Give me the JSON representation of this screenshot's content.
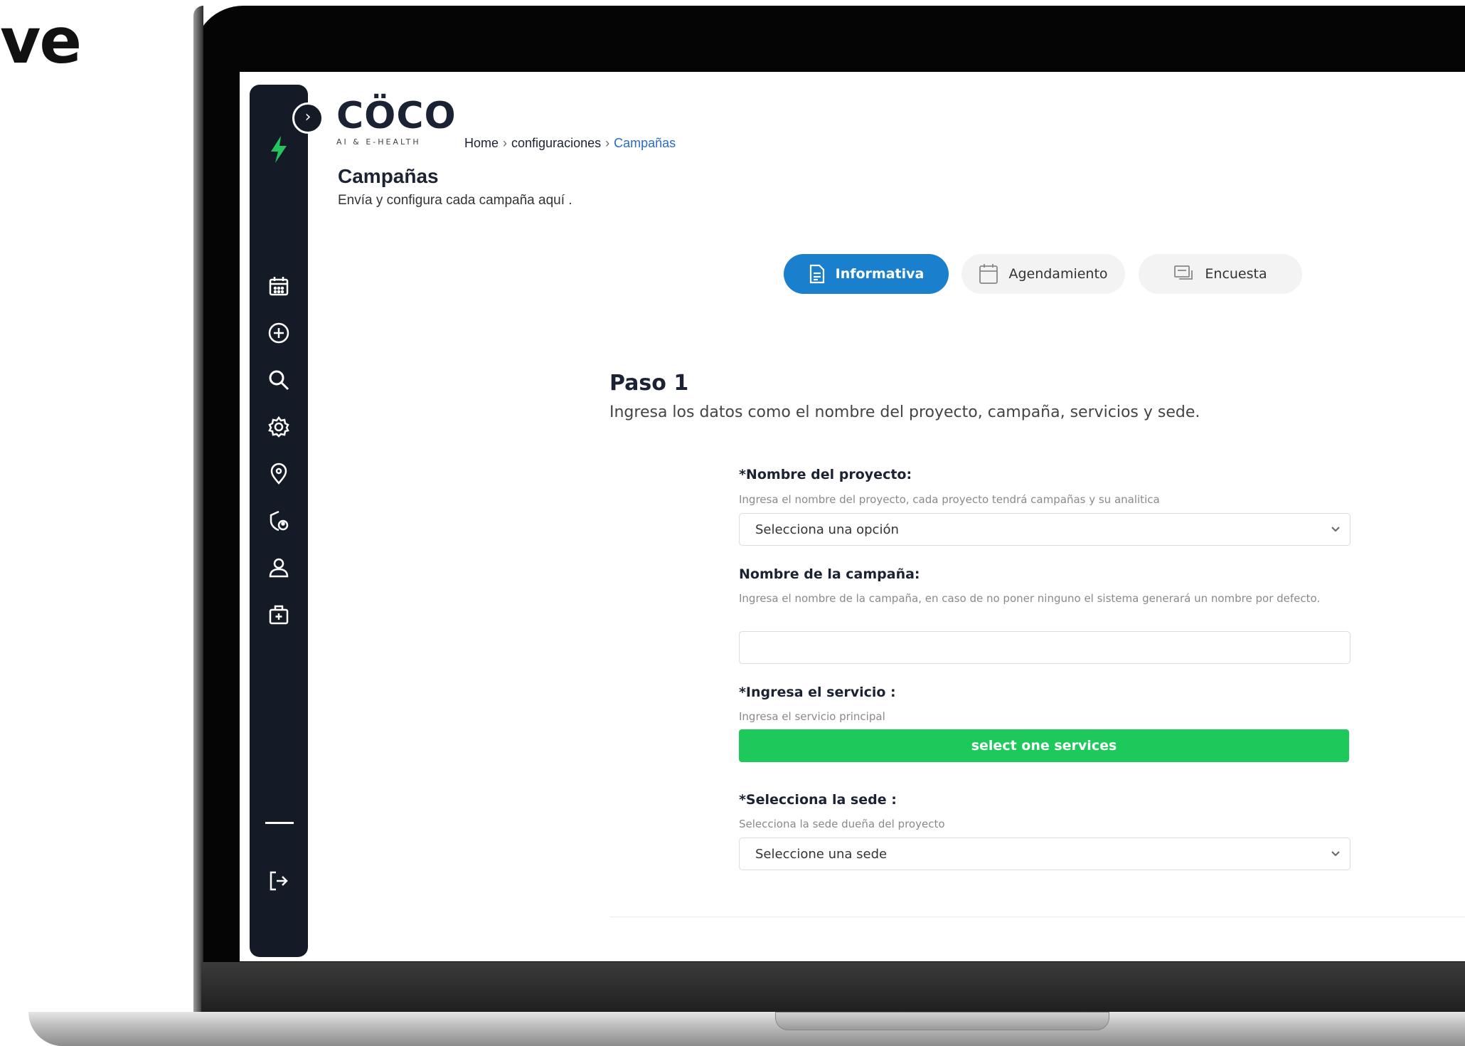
{
  "heading_fragment": "ve",
  "brand": {
    "logo_text": "CÖCO",
    "logo_subtitle": "AI & E-HEALTH"
  },
  "breadcrumb": {
    "home": "Home",
    "section": "configuraciones",
    "current": "Campañas"
  },
  "page": {
    "title": "Campañas",
    "subtitle": "Envía y configura cada campaña aquí ."
  },
  "tabs": [
    {
      "label": "Informativa",
      "icon": "document-icon",
      "active": true
    },
    {
      "label": "Agendamiento",
      "icon": "calendar-icon",
      "active": false
    },
    {
      "label": "Encuesta",
      "icon": "chat-icon",
      "active": false
    }
  ],
  "step": {
    "title": "Paso 1",
    "description": "Ingresa los datos como el nombre del proyecto, campaña, servicios y sede."
  },
  "form": {
    "project": {
      "label": "*Nombre del proyecto:",
      "help": "Ingresa el nombre del proyecto, cada proyecto tendrá campañas y su analitica",
      "value": "Selecciona una opción"
    },
    "campaign": {
      "label": "Nombre de la campaña:",
      "help": "Ingresa el nombre de la campaña, en caso de no poner ninguno el sistema generará un nombre por defecto.",
      "value": ""
    },
    "service": {
      "label": "*Ingresa el servicio :",
      "help": "Ingresa el servicio principal",
      "button_label": "select one services"
    },
    "site": {
      "label": "*Selecciona la sede :",
      "help": "Selecciona la sede dueña del proyecto",
      "value": "Seleccione una sede"
    }
  },
  "sidebar_icons": [
    "bolt-icon",
    "calendar-icon",
    "add-circle-icon",
    "search-icon",
    "settings-icon",
    "location-icon",
    "shield-user-icon",
    "user-icon",
    "medical-kit-icon",
    "logout-icon"
  ],
  "colors": {
    "sidebar": "#141a26",
    "accent_blue": "#1a7fcd",
    "accent_green": "#1ec95c",
    "bolt": "#22c55e"
  }
}
